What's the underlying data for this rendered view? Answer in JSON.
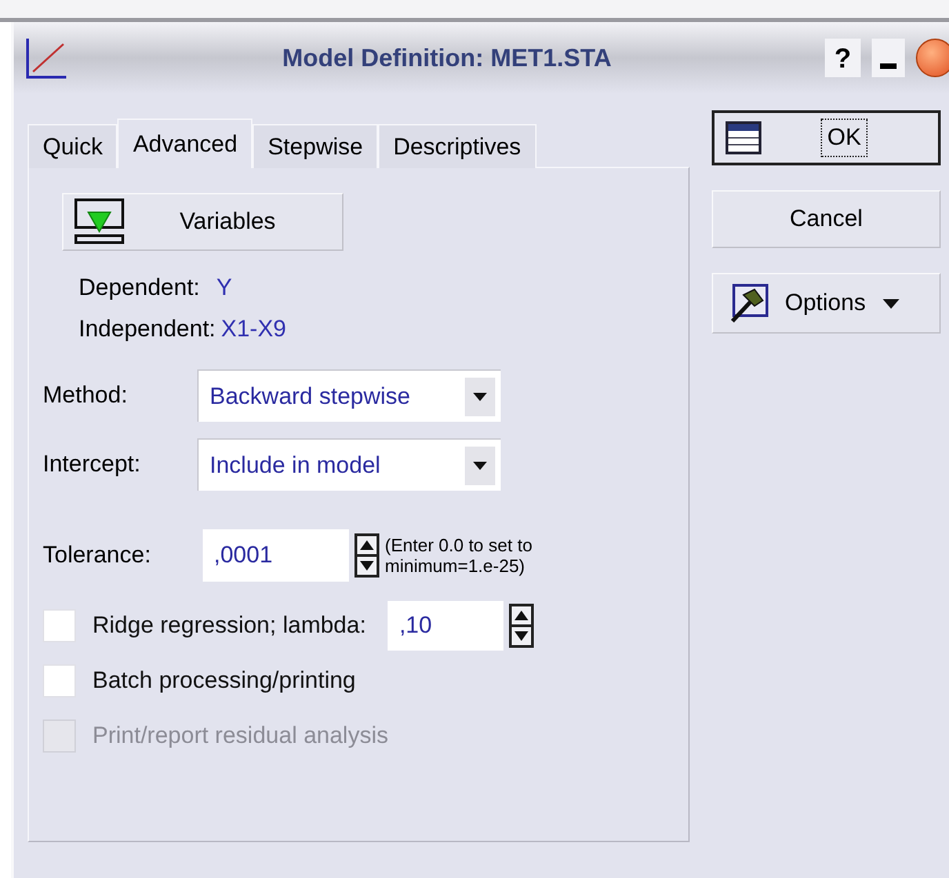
{
  "window": {
    "title": "Model Definition: MET1.STA",
    "help": "?"
  },
  "tabs": [
    {
      "label": "Quick",
      "selected": false
    },
    {
      "label": "Advanced",
      "selected": true
    },
    {
      "label": "Stepwise",
      "selected": false
    },
    {
      "label": "Descriptives",
      "selected": false
    }
  ],
  "variables_button": "Variables",
  "dependent": {
    "label": "Dependent:",
    "value": "Y"
  },
  "independent": {
    "label": "Independent:",
    "value": "X1-X9"
  },
  "method": {
    "label": "Method:",
    "value": "Backward stepwise"
  },
  "intercept": {
    "label": "Intercept:",
    "value": "Include in model"
  },
  "tolerance": {
    "label": "Tolerance:",
    "value": ",0001",
    "hint": "(Enter 0.0 to set to minimum=1.e-25)"
  },
  "checkboxes": [
    {
      "kind": "spinner",
      "label": "Ridge regression; lambda:",
      "checked": false,
      "disabled": false,
      "value": ",10"
    },
    {
      "kind": "plain",
      "label": "Batch processing/printing",
      "checked": false,
      "disabled": false
    },
    {
      "kind": "plain",
      "label": "Print/report residual analysis",
      "checked": false,
      "disabled": true
    }
  ],
  "buttons": {
    "ok": "OK",
    "cancel": "Cancel",
    "options": "Options"
  }
}
